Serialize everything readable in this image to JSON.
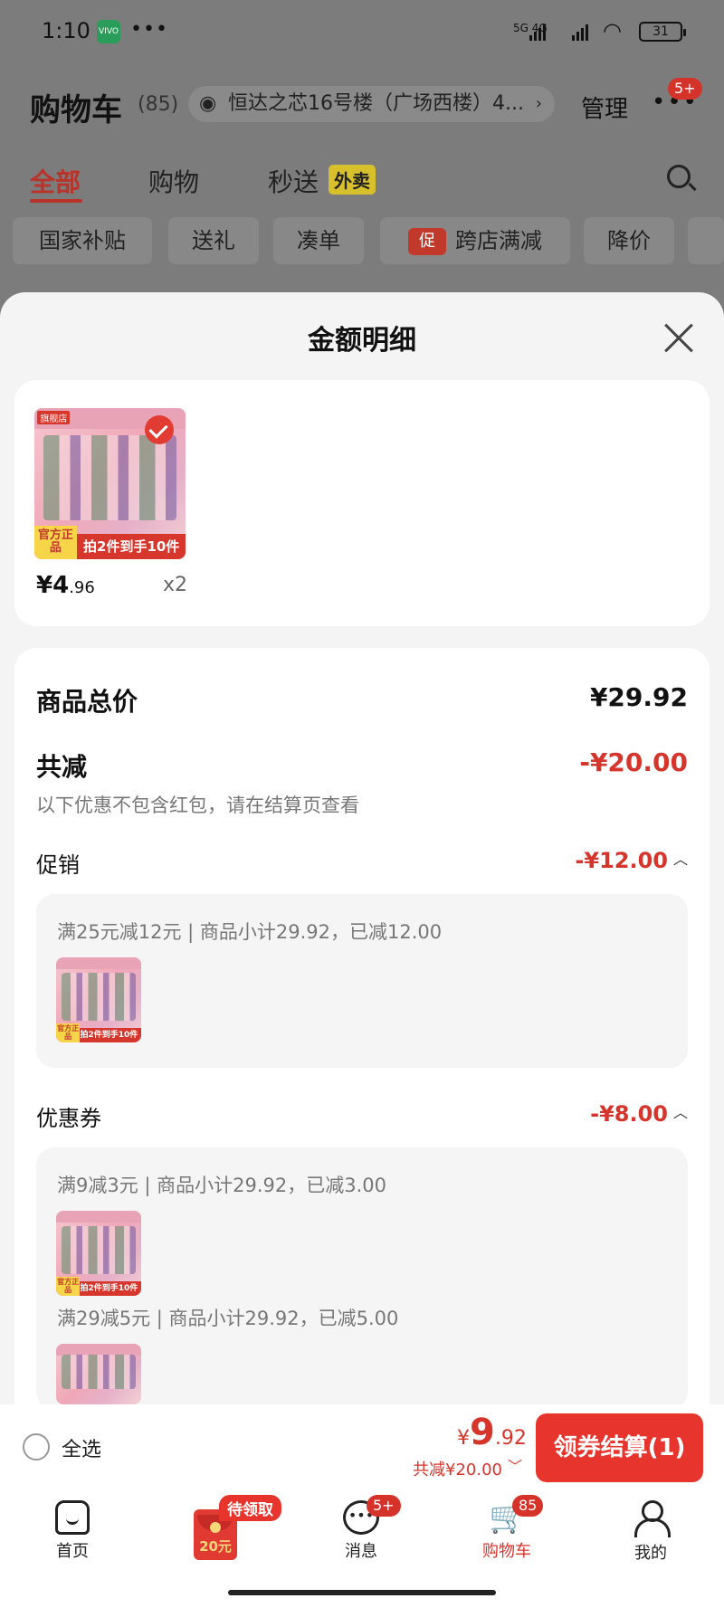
{
  "status_bar": {
    "time": "1:10",
    "app_badge": "VIVO",
    "dots": "•••",
    "network": "5G 4G",
    "battery": "31"
  },
  "header": {
    "title": "购物车",
    "count": "(85)",
    "address": "恒达之芯16号楼（广场西楼）4...",
    "manage": "管理",
    "more_badge": "5+"
  },
  "tabs": [
    {
      "label": "全部"
    },
    {
      "label": "购物"
    },
    {
      "label": "秒送"
    }
  ],
  "waimai_tag": "外卖",
  "chips": [
    {
      "label": "国家补贴"
    },
    {
      "label": "送礼"
    },
    {
      "label": "凑单"
    },
    {
      "label": "跨店满减",
      "icon_text": "促"
    },
    {
      "label": "降价"
    }
  ],
  "sheet": {
    "title": "金额明细",
    "product": {
      "price_int": "¥4",
      "price_dec": ".96",
      "qty": "x2",
      "thumb_tag": "旗舰店",
      "thumb_strip": "拍2件到手10件",
      "thumb_badge": "官方正品"
    },
    "summary": {
      "total_label": "商品总价",
      "total_value": "¥29.92",
      "reduce_label": "共减",
      "reduce_value": "-¥20.00",
      "note": "以下优惠不包含红包，请在结算页查看"
    },
    "promotion": {
      "label": "促销",
      "value": "-¥12.00",
      "detail": "满25元减12元 | 商品小计29.92，已减12.00"
    },
    "coupon": {
      "label": "优惠券",
      "value": "-¥8.00",
      "details": [
        "满9减3元 | 商品小计29.92，已减3.00",
        "满29减5元 | 商品小计29.92，已减5.00"
      ]
    }
  },
  "checkout": {
    "select_all": "全选",
    "currency": "¥",
    "total_int": "9",
    "total_dec": ".92",
    "saving": "共减¥20.00",
    "button": "领券结算(1)"
  },
  "tabbar": {
    "items": [
      {
        "label": "首页"
      },
      {
        "label": ""
      },
      {
        "label": "消息"
      },
      {
        "label": "购物车"
      },
      {
        "label": "我的"
      }
    ],
    "claim": "待领取",
    "envelope_amount": "20元",
    "msg_badge": "5+",
    "cart_badge": "85"
  },
  "colors": {
    "accent": "#e7342d",
    "discount_red": "#d6352c"
  }
}
